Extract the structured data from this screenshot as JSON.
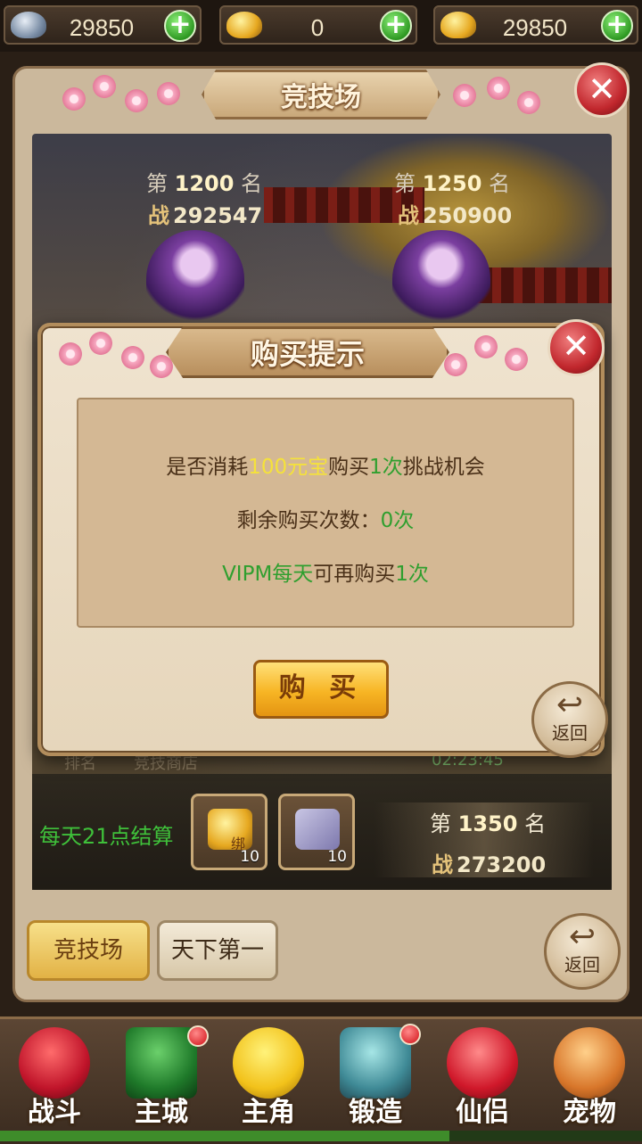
{
  "currency": [
    {
      "icon": "silver-ingot-icon",
      "value": "29850"
    },
    {
      "icon": "gold-ingot-icon",
      "value": "0"
    },
    {
      "icon": "gold-ingot-icon",
      "value": "29850"
    }
  ],
  "arena": {
    "title": "竞技场",
    "opponents": [
      {
        "rank_prefix": "第",
        "rank": "1200",
        "rank_suffix": "名",
        "power_label": "战",
        "power": "292547"
      },
      {
        "rank_prefix": "第",
        "rank": "1250",
        "rank_suffix": "名",
        "power_label": "战",
        "power": "250900"
      }
    ],
    "settle_text": "每天21点结算",
    "rewards": [
      {
        "icon": "bound-gold-ingot-icon",
        "tag": "绑",
        "count": "10"
      },
      {
        "icon": "arena-token-icon",
        "count": "10"
      }
    ],
    "my_rank": {
      "rank_prefix": "第",
      "rank": "1350",
      "rank_suffix": "名",
      "power_label": "战",
      "power": "273200"
    },
    "partial_labels": {
      "rank": "排名",
      "shop": "竞技商店",
      "timer": "02:23:45"
    },
    "tabs": [
      {
        "label": "竞技场",
        "active": true
      },
      {
        "label": "天下第一",
        "active": false
      }
    ],
    "back_label": "返回"
  },
  "dialog": {
    "title": "购买提示",
    "line1": {
      "pre": "是否消耗",
      "cost": "100元宝",
      "mid": "购买",
      "times": "1次",
      "post": "挑战机会"
    },
    "line2": {
      "pre": "剩余购买次数：",
      "count": "0次"
    },
    "line3": {
      "vip": "VIPM每天",
      "mid": "可再购买",
      "times": "1次"
    },
    "buy_label": "购 买",
    "back_label": "返回"
  },
  "nav": [
    {
      "label": "战斗",
      "icon": "battle-icon",
      "badge": false
    },
    {
      "label": "主城",
      "icon": "main-city-icon",
      "badge": true
    },
    {
      "label": "主角",
      "icon": "hero-icon",
      "badge": false
    },
    {
      "label": "锻造",
      "icon": "forge-icon",
      "badge": true
    },
    {
      "label": "仙侣",
      "icon": "companion-icon",
      "badge": false
    },
    {
      "label": "宠物",
      "icon": "pet-icon",
      "badge": false
    }
  ],
  "colors": {
    "accent_green": "#2f9f2f",
    "accent_yellow": "#f5e23a",
    "close_red": "#c1272d",
    "buy_gold": "#f7b524"
  },
  "progress": 0.7
}
